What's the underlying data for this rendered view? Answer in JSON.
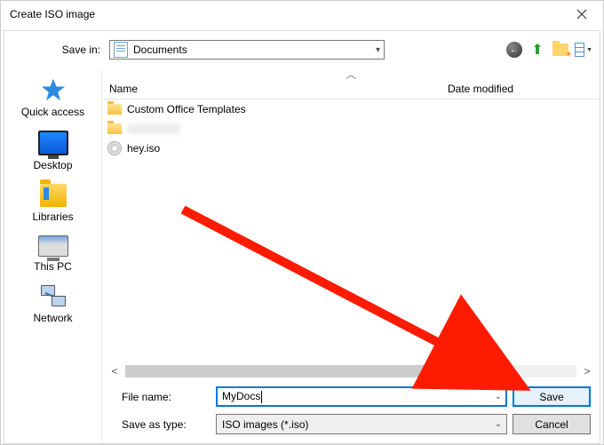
{
  "window": {
    "title": "Create ISO image"
  },
  "nav": {
    "save_in_label": "Save in:",
    "save_in_value": "Documents"
  },
  "columns": {
    "name": "Name",
    "date": "Date modified"
  },
  "sidebar": {
    "items": [
      {
        "label": "Quick access"
      },
      {
        "label": "Desktop"
      },
      {
        "label": "Libraries"
      },
      {
        "label": "This PC"
      },
      {
        "label": "Network"
      }
    ]
  },
  "files": [
    {
      "name": "Custom Office Templates",
      "type": "folder"
    },
    {
      "name": "",
      "type": "folder"
    },
    {
      "name": "hey.iso",
      "type": "iso"
    }
  ],
  "form": {
    "file_name_label": "File name:",
    "file_name_value": "MyDocs",
    "save_as_type_label": "Save as type:",
    "save_as_type_value": "ISO images (*.iso)",
    "save_btn": "Save",
    "cancel_btn": "Cancel"
  }
}
